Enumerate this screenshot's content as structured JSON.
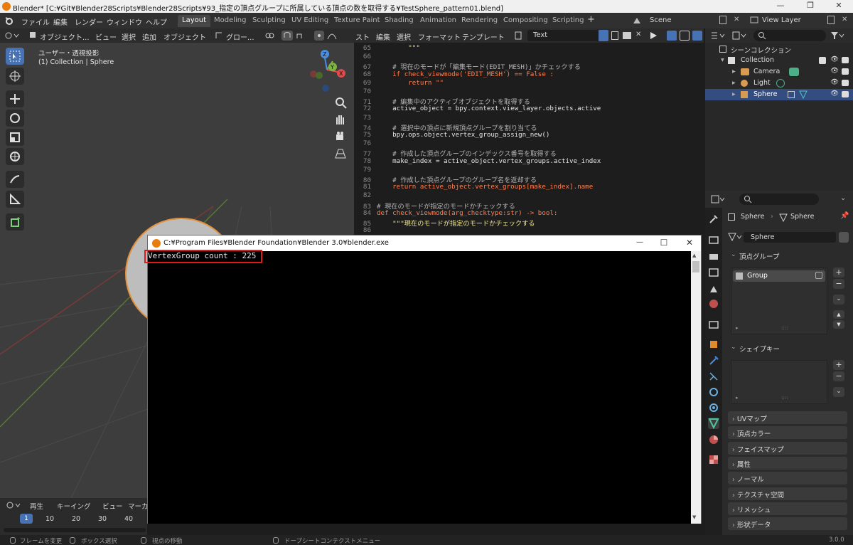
{
  "window": {
    "title": "Blender* [C:¥Git¥Blender28Scripts¥Blender28Scripts¥93_指定の頂点グループに所属している頂点の数を取得する¥TestSphere_pattern01.blend]",
    "minimize": "—",
    "maximize": "❐",
    "close": "✕"
  },
  "menubar": {
    "menus": [
      "ファイル",
      "編集",
      "レンダー",
      "ウィンドウ",
      "ヘルプ"
    ],
    "workspaces": [
      "Layout",
      "Modeling",
      "Sculpting",
      "UV Editing",
      "Texture Paint",
      "Shading",
      "Animation",
      "Rendering",
      "Compositing",
      "Scripting"
    ],
    "active_workspace": "Layout",
    "add_tab": "+",
    "scene": "Scene",
    "view_layer": "View Layer"
  },
  "viewport": {
    "mode": "オブジェクト...",
    "menus": [
      "ビュー",
      "選択",
      "追加",
      "オブジェクト"
    ],
    "transform": "グロー...",
    "overlay_title": "ユーザー・透視投影",
    "overlay_subtitle": "(1) Collection | Sphere",
    "gizmo_axes": [
      "X",
      "Y",
      "Z"
    ]
  },
  "text_editor": {
    "menus": [
      "スト",
      "編集",
      "選択",
      "フォーマット",
      "テンプレート"
    ],
    "text_name": "Text",
    "lines": [
      {
        "n": "65",
        "t": "        \"\"\"",
        "k": "str"
      },
      {
        "n": "66",
        "t": "",
        "k": ""
      },
      {
        "n": "67",
        "t": "    # 現在のモードが「編集モード(EDIT_MESH)」かチェックする",
        "k": "comment"
      },
      {
        "n": "68",
        "t": "    if check_viewmode('EDIT_MESH') == False :",
        "k": "kw"
      },
      {
        "n": "69",
        "t": "        return \"\"",
        "k": "kw"
      },
      {
        "n": "70",
        "t": "",
        "k": ""
      },
      {
        "n": "71",
        "t": "    # 編集中のアクティブオブジェクトを取得する",
        "k": "comment"
      },
      {
        "n": "72",
        "t": "    active_object = bpy.context.view_layer.objects.active",
        "k": ""
      },
      {
        "n": "73",
        "t": "",
        "k": ""
      },
      {
        "n": "74",
        "t": "    # 選択中の頂点に新規頂点グループを割り当てる",
        "k": "comment"
      },
      {
        "n": "75",
        "t": "    bpy.ops.object.vertex_group_assign_new()",
        "k": ""
      },
      {
        "n": "76",
        "t": "",
        "k": ""
      },
      {
        "n": "77",
        "t": "    # 作成した頂点グループのインデックス番号を取得する",
        "k": "comment"
      },
      {
        "n": "78",
        "t": "    make_index = active_object.vertex_groups.active_index",
        "k": ""
      },
      {
        "n": "79",
        "t": "",
        "k": ""
      },
      {
        "n": "80",
        "t": "    # 作成した頂点グループのグループ名を返却する",
        "k": "comment"
      },
      {
        "n": "81",
        "t": "    return active_object.vertex_groups[make_index].name",
        "k": "kw"
      },
      {
        "n": "82",
        "t": "",
        "k": ""
      },
      {
        "n": "83",
        "t": "# 現在のモードが指定のモードかチェックする",
        "k": "comment"
      },
      {
        "n": "84",
        "t": "def check_viewmode(arg_checktype:str) -> bool:",
        "k": "kw"
      },
      {
        "n": "85",
        "t": "    \"\"\"現在のモードが指定のモードかチェックする",
        "k": "str"
      },
      {
        "n": "86",
        "t": "",
        "k": ""
      }
    ]
  },
  "outliner": {
    "root": "シーンコレクション",
    "collection": "Collection",
    "items": [
      "Camera",
      "Light",
      "Sphere"
    ],
    "selected": "Sphere"
  },
  "properties": {
    "breadcrumb_object": "Sphere",
    "breadcrumb_data": "Sphere",
    "data_name": "Sphere",
    "vertex_groups_label": "頂点グループ",
    "vertex_group_item": "Group",
    "shape_keys_label": "シェイプキー",
    "collapsed_panels": [
      "UVマップ",
      "頂点カラー",
      "フェイスマップ",
      "属性",
      "ノーマル",
      "テクスチャ空間",
      "リメッシュ",
      "形状データ"
    ],
    "plus": "+",
    "minus": "−"
  },
  "console": {
    "title": "C:¥Program Files¥Blender Foundation¥Blender 3.0¥blender.exe",
    "output": "VertexGroup count : 225",
    "minimize": "—",
    "maximize": "☐",
    "close": "✕"
  },
  "timeline": {
    "menus": [
      "再生",
      "キーイング",
      "ビュー",
      "マーカ"
    ],
    "current_frame": "1",
    "frames": [
      "10",
      "20",
      "30",
      "40"
    ]
  },
  "statusbar": {
    "items": [
      "フレームを変更",
      "ボックス選択",
      "視点の移動",
      "ドープシートコンテクストメニュー"
    ],
    "version": "3.0.0"
  },
  "colors": {
    "accent": "#4772b3",
    "selection": "#334d80",
    "highlight_box": "#e01a1a",
    "blender_orange": "#e87d0d"
  }
}
